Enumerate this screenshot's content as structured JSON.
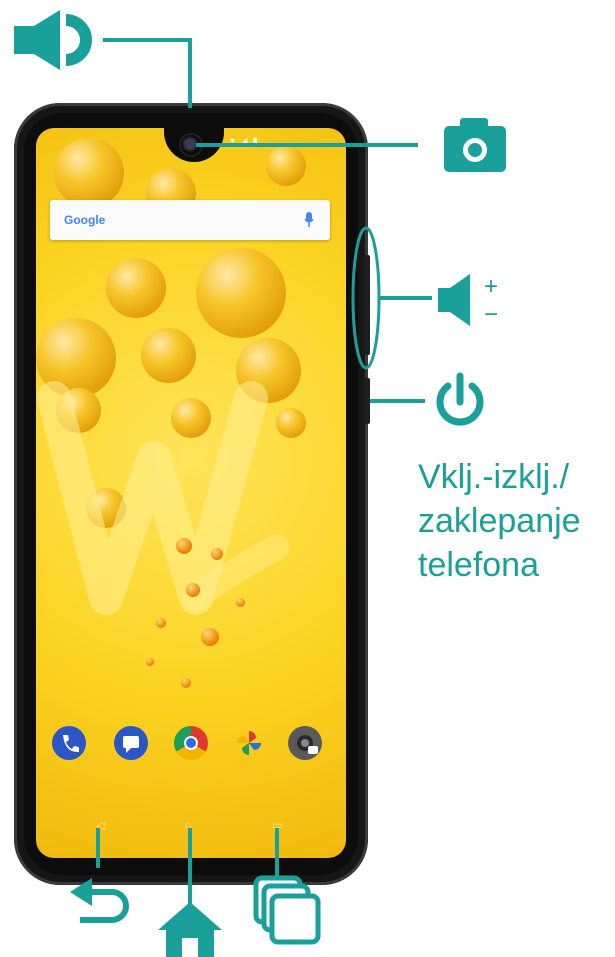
{
  "colors": {
    "accent": "#1aa09b",
    "phone_frame": "#161616",
    "screen_yellow": "#fbd321"
  },
  "screen": {
    "search_bar": {
      "logo_text": "Google",
      "icon": "mic-icon"
    },
    "dock": [
      {
        "icon": "phone-icon",
        "color": "#2a56c6"
      },
      {
        "icon": "messages-icon",
        "color": "#2a56c6"
      },
      {
        "icon": "chrome-icon",
        "color": "#e0382d"
      },
      {
        "icon": "photos-icon",
        "color": "#f2b400"
      },
      {
        "icon": "camera-app-icon",
        "color": "#5a5a5a"
      }
    ]
  },
  "callouts": {
    "earpiece": {
      "icon": "speaker-icon"
    },
    "front_camera": {
      "icon": "camera-icon"
    },
    "volume": {
      "icon": "volume-icon",
      "plus": "+",
      "minus": "−"
    },
    "power": {
      "icon": "power-icon",
      "label_lines": [
        "Vklj.-izklj./",
        "zaklepanje",
        "telefona"
      ]
    },
    "nav": [
      {
        "icon": "back-arrow-icon"
      },
      {
        "icon": "home-icon"
      },
      {
        "icon": "recent-apps-icon"
      }
    ]
  }
}
